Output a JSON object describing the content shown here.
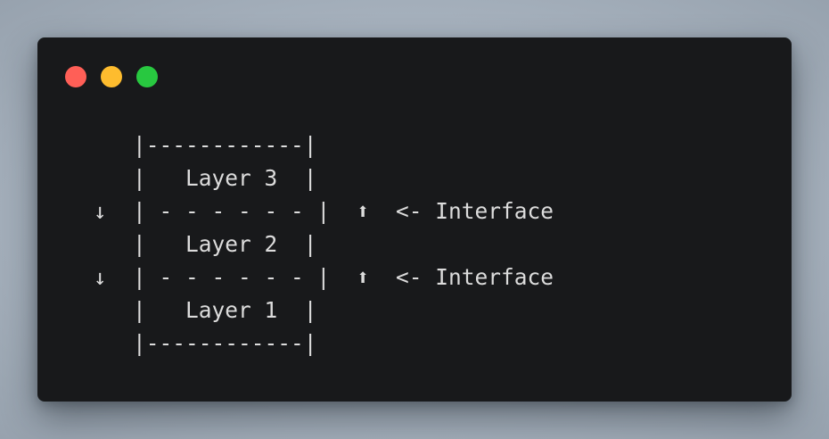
{
  "window": {
    "buttons": {
      "close_color": "#ff5f57",
      "minimize_color": "#febc2e",
      "maximize_color": "#28c840"
    }
  },
  "code": {
    "lines": [
      "    |------------|",
      "    |   Layer 3  |",
      " ↓  | - - - - - - |  ⬆  <- Interface",
      "    |   Layer 2  |",
      " ↓  | - - - - - - |  ⬆  <- Interface",
      "    |   Layer 1  |",
      "    |------------|"
    ]
  }
}
